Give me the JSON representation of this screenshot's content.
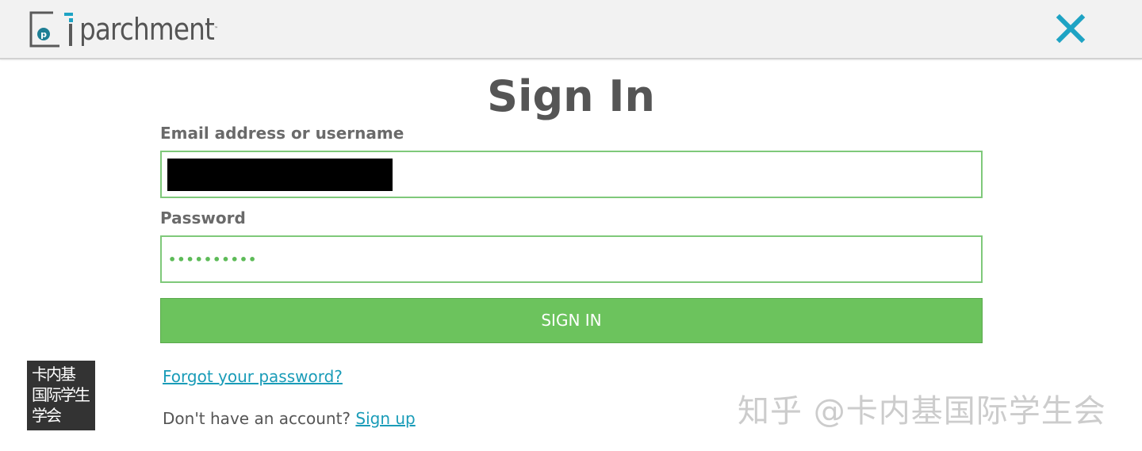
{
  "header": {
    "logo_text": "parchment",
    "logo_tm": "™",
    "logo_icon": "parchment-p-logo-icon",
    "close_icon": "close-icon",
    "accent_color": "#1ea3c4"
  },
  "page": {
    "title": "Sign In"
  },
  "form": {
    "email_label": "Email address or username",
    "email_value": "",
    "password_label": "Password",
    "password_value": "••••••••••",
    "submit_label": "SIGN IN",
    "field_border_color": "#7fc97a",
    "button_color": "#6cc35d"
  },
  "links": {
    "forgot_password": "Forgot your password?",
    "no_account_text": "Don't have an account?",
    "sign_up": "Sign up",
    "link_color": "#1a9cb8"
  },
  "badge": {
    "lines": [
      "卡内基",
      "国际学生",
      "学会"
    ]
  },
  "watermark": {
    "text": "知乎 @卡内基国际学生会"
  }
}
